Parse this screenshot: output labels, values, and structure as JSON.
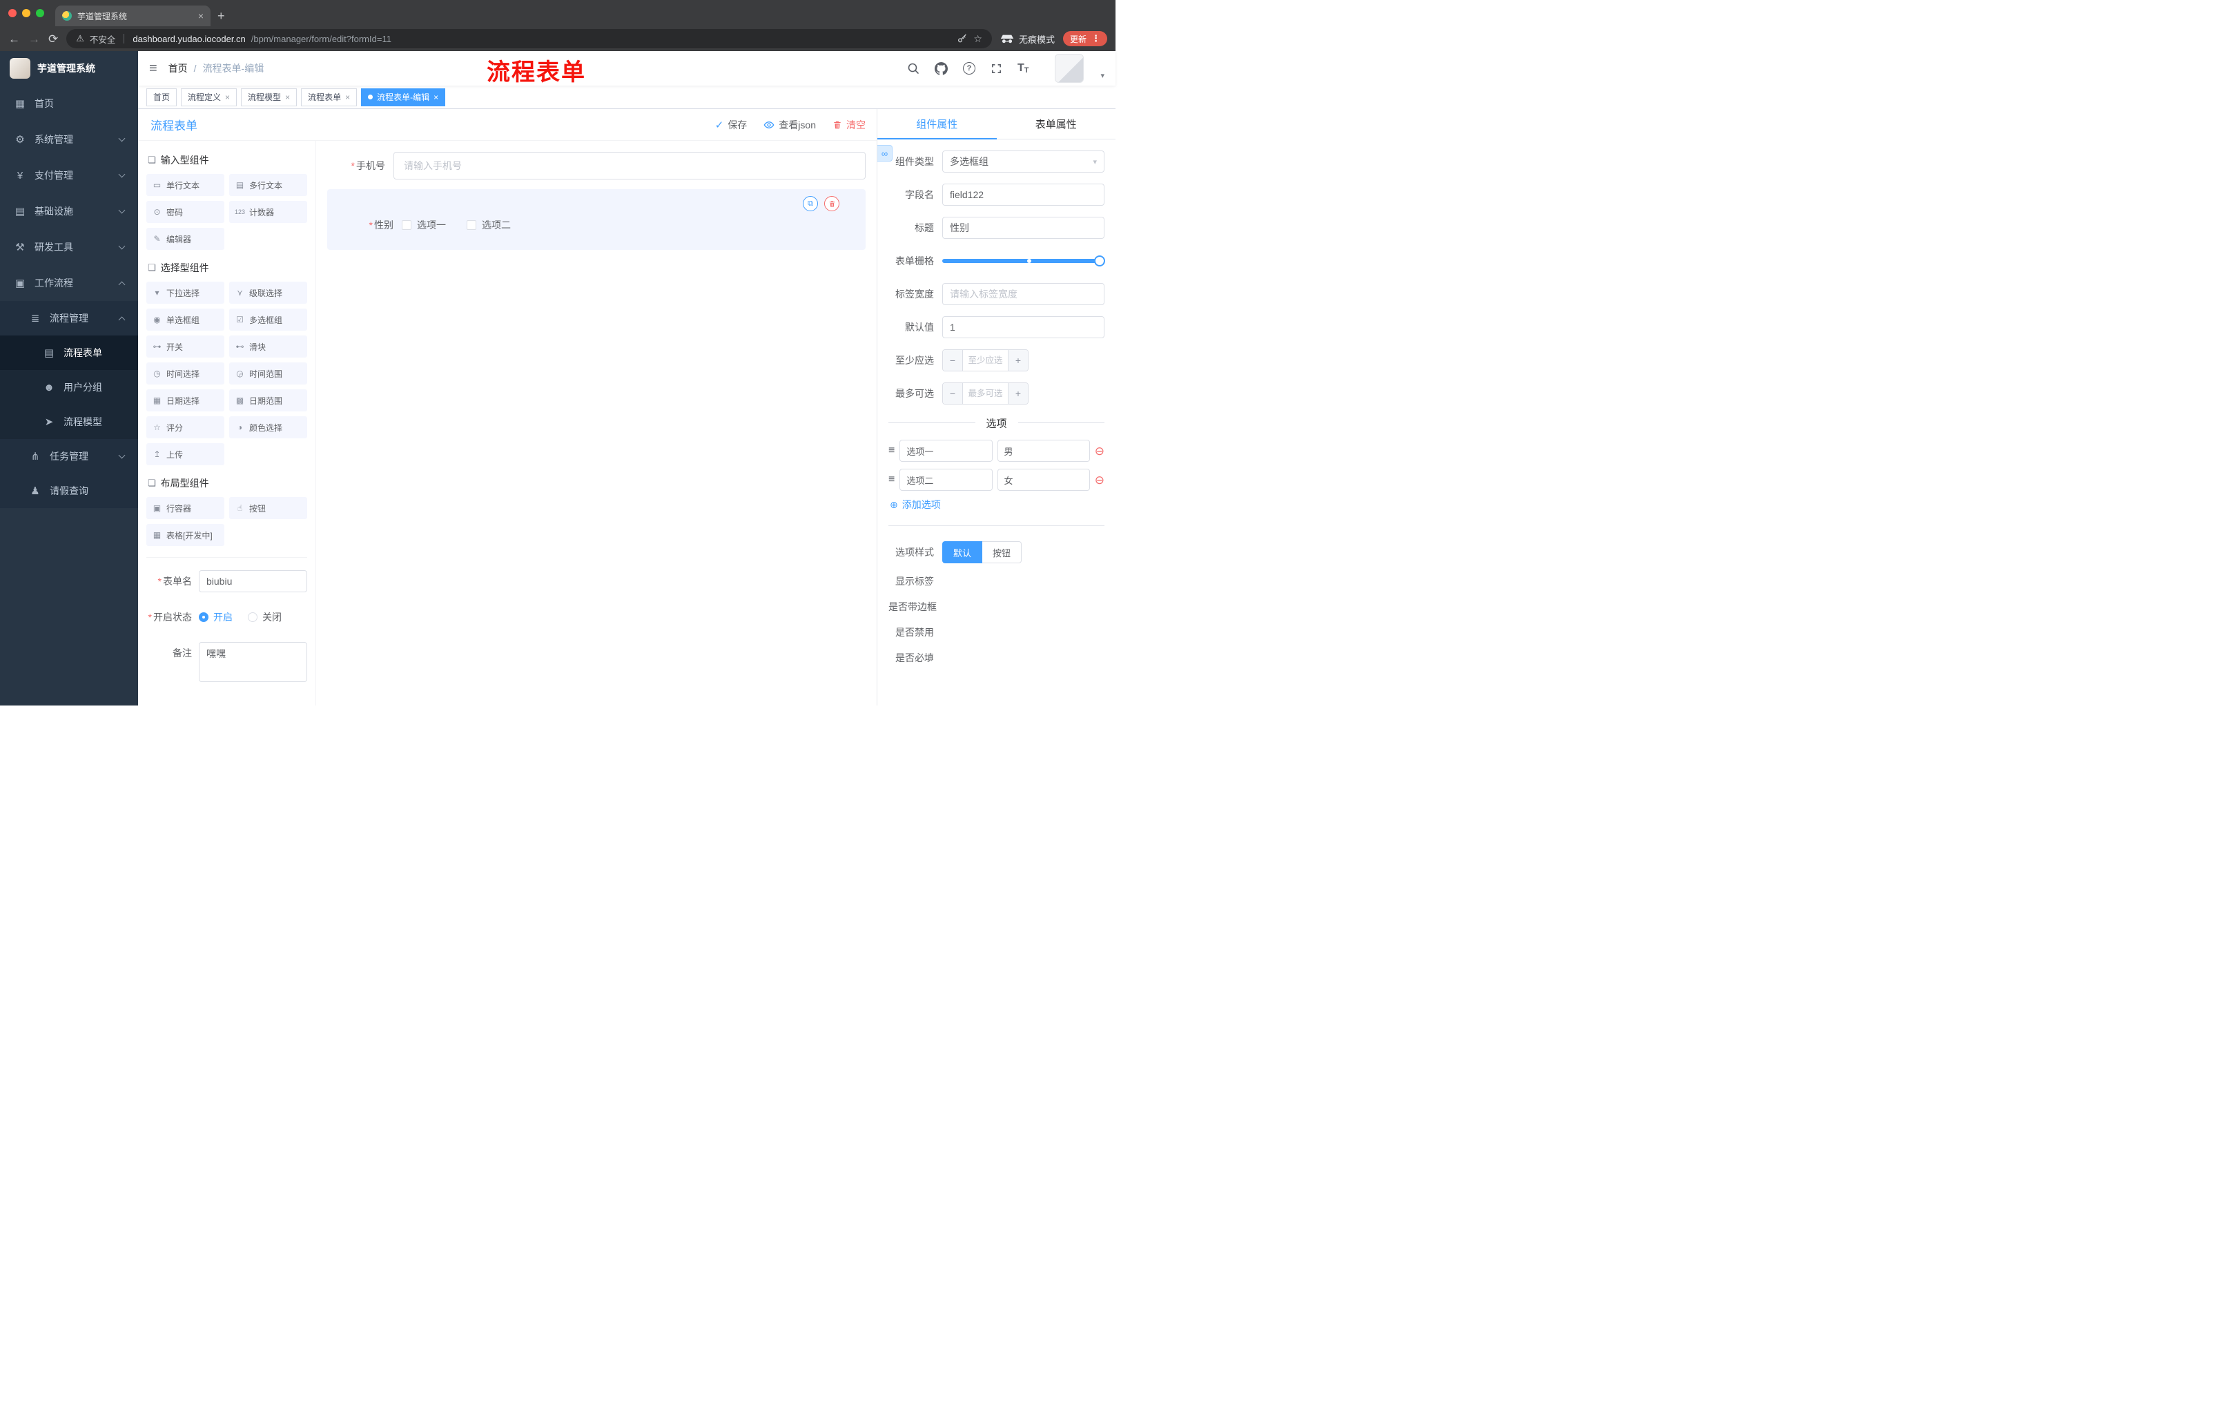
{
  "colors": {
    "accent": "#409eff",
    "danger": "#f56c6c",
    "annotation": "#f5140c",
    "sidebar_bg": "#283645"
  },
  "icons": {
    "warning": "⚠",
    "star": "☆",
    "menu_dots": "⋮",
    "back": "←",
    "forward": "→",
    "reload": "⟳",
    "hamburger": "≡",
    "plus": "+",
    "close": "×",
    "check": "✓",
    "copy": "⧉",
    "link": "∞",
    "minus_circle": "⊖",
    "add_circle": "⊕",
    "handle": "≡",
    "caret": "▾",
    "help": "?",
    "fontsize": "T",
    "required": "*",
    "minus": "−",
    "slash": "/"
  },
  "browser": {
    "tab": {
      "title": "芋道管理系统"
    },
    "address": {
      "security": "不安全",
      "domain": "dashboard.yudao.iocoder.cn",
      "path": "/bpm/manager/form/edit?formId=11"
    },
    "incognito": "无痕模式",
    "update": "更新"
  },
  "sidebar": {
    "title": "芋道管理系统",
    "menu": [
      {
        "label": "首页",
        "icon": "▦"
      },
      {
        "label": "系统管理",
        "icon": "⚙"
      },
      {
        "label": "支付管理",
        "icon": "¥"
      },
      {
        "label": "基础设施",
        "icon": "▤"
      },
      {
        "label": "研发工具",
        "icon": "⚒"
      },
      {
        "label": "工作流程",
        "icon": "▣"
      },
      {
        "label": "流程管理",
        "icon": "≣"
      },
      {
        "label": "流程表单",
        "icon": "▤"
      },
      {
        "label": "用户分组",
        "icon": "☻"
      },
      {
        "label": "流程模型",
        "icon": "➤"
      },
      {
        "label": "任务管理",
        "icon": "⋔"
      },
      {
        "label": "请假查询",
        "icon": "♟"
      }
    ]
  },
  "navbar": {
    "breadcrumb": [
      "首页",
      "流程表单-编辑"
    ],
    "separator": "/",
    "annotation": "流程表单"
  },
  "tags": [
    {
      "label": "首页"
    },
    {
      "label": "流程定义"
    },
    {
      "label": "流程模型"
    },
    {
      "label": "流程表单"
    },
    {
      "label": "流程表单-编辑"
    }
  ],
  "designer": {
    "title": "流程表单",
    "actions": {
      "save": "保存",
      "view_json": "查看json",
      "clear": "清空"
    }
  },
  "palette": {
    "sections": [
      {
        "title": "输入型组件",
        "icon": "❏",
        "items": [
          {
            "label": "单行文本",
            "icon": "▭"
          },
          {
            "label": "多行文本",
            "icon": "▤"
          },
          {
            "label": "密码",
            "icon": "⊙"
          },
          {
            "label": "计数器",
            "icon": "123"
          },
          {
            "label": "编辑器",
            "icon": "✎"
          }
        ]
      },
      {
        "title": "选择型组件",
        "icon": "❏",
        "items": [
          {
            "label": "下拉选择",
            "icon": "▾"
          },
          {
            "label": "级联选择",
            "icon": "⋎"
          },
          {
            "label": "单选框组",
            "icon": "◉"
          },
          {
            "label": "多选框组",
            "icon": "☑"
          },
          {
            "label": "开关",
            "icon": "⊶"
          },
          {
            "label": "滑块",
            "icon": "⊷"
          },
          {
            "label": "时间选择",
            "icon": "◷"
          },
          {
            "label": "时间范围",
            "icon": "◶"
          },
          {
            "label": "日期选择",
            "icon": "▦"
          },
          {
            "label": "日期范围",
            "icon": "▩"
          },
          {
            "label": "评分",
            "icon": "☆"
          },
          {
            "label": "颜色选择",
            "icon": "◑"
          },
          {
            "label": "上传",
            "icon": "↥"
          }
        ]
      },
      {
        "title": "布局型组件",
        "icon": "❏",
        "items": [
          {
            "label": "行容器",
            "icon": "▣"
          },
          {
            "label": "按钮",
            "icon": "☝"
          },
          {
            "label": "表格[开发中]",
            "icon": "▦"
          }
        ]
      }
    ],
    "form": {
      "name_label": "表单名",
      "name_value": "biubiu",
      "status_label": "开启状态",
      "status_on": "开启",
      "status_off": "关闭",
      "remark_label": "备注",
      "remark_value": "嘿嘿"
    }
  },
  "canvas": {
    "phone_label": "手机号",
    "phone_placeholder": "请输入手机号",
    "gender_label": "性别",
    "gender_options": [
      "选项一",
      "选项二"
    ]
  },
  "props": {
    "tab_component": "组件属性",
    "tab_form": "表单属性",
    "rows": {
      "type_label": "组件类型",
      "type_value": "多选框组",
      "field_label": "字段名",
      "field_value": "field122",
      "title_label": "标题",
      "title_value": "性别",
      "grid_label": "表单栅格",
      "labelwidth_label": "标签宽度",
      "labelwidth_placeholder": "请输入标签宽度",
      "default_label": "默认值",
      "default_value": "1",
      "min_label": "至少应选",
      "min_placeholder": "至少应选",
      "max_label": "最多可选",
      "max_placeholder": "最多可选"
    },
    "options_title": "选项",
    "option_rows": [
      {
        "label": "选项一",
        "value": "男"
      },
      {
        "label": "选项二",
        "value": "女"
      }
    ],
    "add_option": "添加选项",
    "style_label": "选项样式",
    "style_options": [
      "默认",
      "按钮"
    ],
    "style_selected": "默认",
    "switches": [
      {
        "label": "显示标签",
        "on": true
      },
      {
        "label": "是否带边框",
        "on": false
      },
      {
        "label": "是否禁用",
        "on": false
      },
      {
        "label": "是否必填",
        "on": true
      }
    ]
  }
}
